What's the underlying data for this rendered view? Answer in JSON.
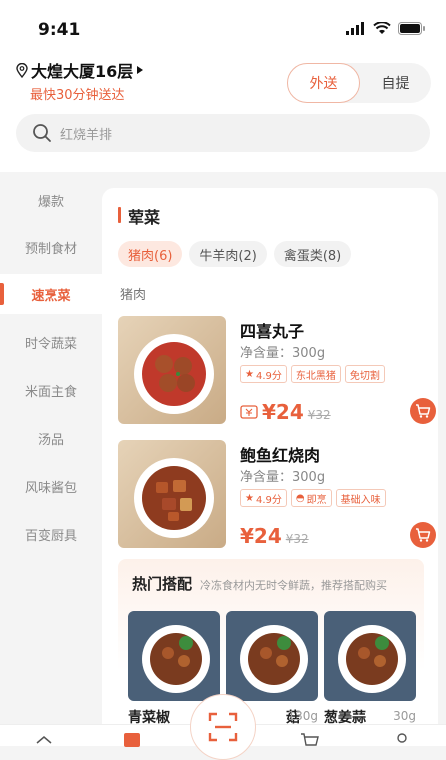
{
  "status": {
    "time": "9:41"
  },
  "location": {
    "name": "大煌大厦16层",
    "delivery_note": "最快30分钟送达"
  },
  "mode_toggle": {
    "options": [
      "外送",
      "自提"
    ],
    "active": 0
  },
  "search": {
    "placeholder": "红烧羊排"
  },
  "sidebar": {
    "items": [
      {
        "label": "爆款"
      },
      {
        "label": "预制食材"
      },
      {
        "label": "速烹菜"
      },
      {
        "label": "时令蔬菜"
      },
      {
        "label": "米面主食"
      },
      {
        "label": "汤品"
      },
      {
        "label": "风味酱包"
      },
      {
        "label": "百变厨具"
      }
    ],
    "active_index": 2
  },
  "category": {
    "title": "荤菜",
    "chips": [
      {
        "label": "猪肉(6)"
      },
      {
        "label": "牛羊肉(2)"
      },
      {
        "label": "禽蛋类(8)"
      }
    ],
    "active_chip": 0,
    "subheading": "猪肉"
  },
  "products": [
    {
      "name": "四喜丸子",
      "net": "净含量：300g",
      "tags": [
        "4.9分",
        "东北黑猪",
        "免切割"
      ],
      "price": "¥24",
      "old_price": "¥32"
    },
    {
      "name": "鲍鱼红烧肉",
      "net": "净含量：300g",
      "tags": [
        "4.9分",
        "即烹",
        "基础入味"
      ],
      "price": "¥24",
      "old_price": "¥32"
    }
  ],
  "combo": {
    "title": "热门搭配",
    "subtitle": "冷冻食材内无时令鲜蔬，推荐搭配购买",
    "items": [
      {
        "name": "青菜椒",
        "weight": ""
      },
      {
        "name": "菇",
        "weight": "130g"
      },
      {
        "name": "葱姜蒜",
        "weight": "30g"
      }
    ]
  },
  "colors": {
    "accent": "#e8603c",
    "accent_light": "#fde8e0",
    "background": "#f4f4f4"
  }
}
